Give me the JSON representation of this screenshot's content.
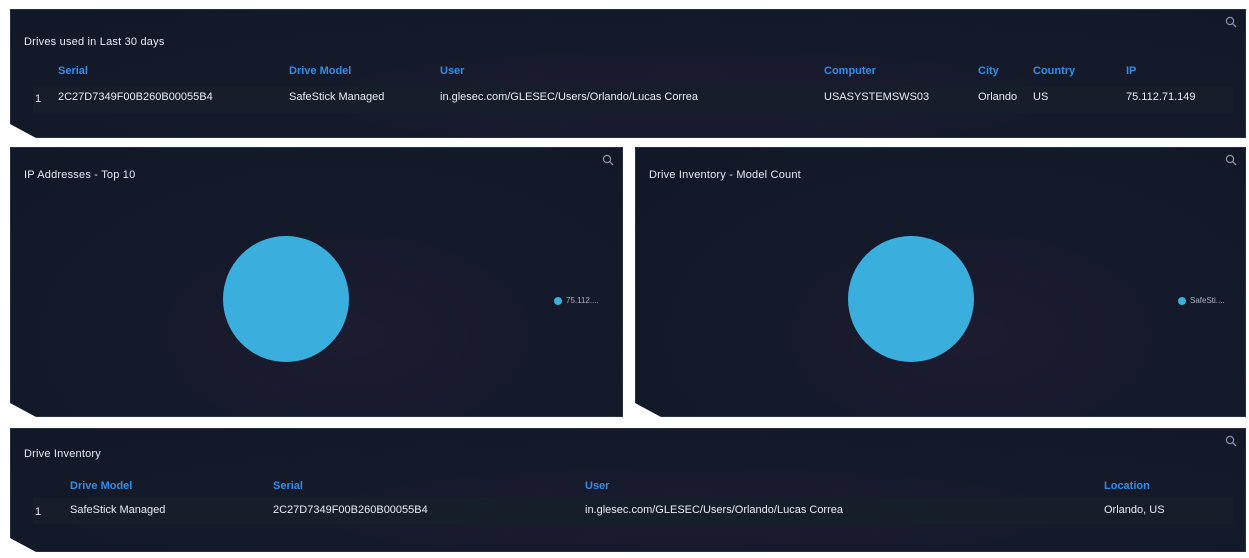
{
  "colors": {
    "header_blue": "#2f8ee8",
    "slice_blue": "#3aaedc",
    "panel_bg": "#141a2a"
  },
  "drives_panel": {
    "title": "Drives used in Last 30 days",
    "columns": [
      "Serial",
      "Drive Model",
      "User",
      "Computer",
      "City",
      "Country",
      "IP"
    ],
    "rows": [
      {
        "num": "1",
        "serial": "2C27D7349F00B260B00055B4",
        "drive_model": "SafeStick Managed",
        "user": "in.glesec.com/GLESEC/Users/Orlando/Lucas Correa",
        "computer": "USASYSTEMSWS03",
        "city": "Orlando",
        "country": "US",
        "ip": "75.112.71.149"
      }
    ],
    "search_icon": "search-icon"
  },
  "ip_panel": {
    "title": "IP Addresses - Top 10",
    "search_icon": "search-icon",
    "legend_label": "75.112...."
  },
  "model_panel": {
    "title": "Drive Inventory - Model Count",
    "search_icon": "search-icon",
    "legend_label": "SafeSti...."
  },
  "chart_data": [
    {
      "type": "pie",
      "title": "IP Addresses - Top 10",
      "categories": [
        "75.112.71.149"
      ],
      "values": [
        1
      ],
      "colors": [
        "#3aaedc"
      ],
      "legend": "right"
    },
    {
      "type": "pie",
      "title": "Drive Inventory - Model Count",
      "categories": [
        "SafeStick Managed"
      ],
      "values": [
        1
      ],
      "colors": [
        "#3aaedc"
      ],
      "legend": "right"
    }
  ],
  "inventory_panel": {
    "title": "Drive Inventory",
    "columns": [
      "Drive Model",
      "Serial",
      "User",
      "Location"
    ],
    "rows": [
      {
        "num": "1",
        "drive_model": "SafeStick Managed",
        "serial": "2C27D7349F00B260B00055B4",
        "user": "in.glesec.com/GLESEC/Users/Orlando/Lucas Correa",
        "location": "Orlando, US"
      }
    ],
    "search_icon": "search-icon"
  }
}
